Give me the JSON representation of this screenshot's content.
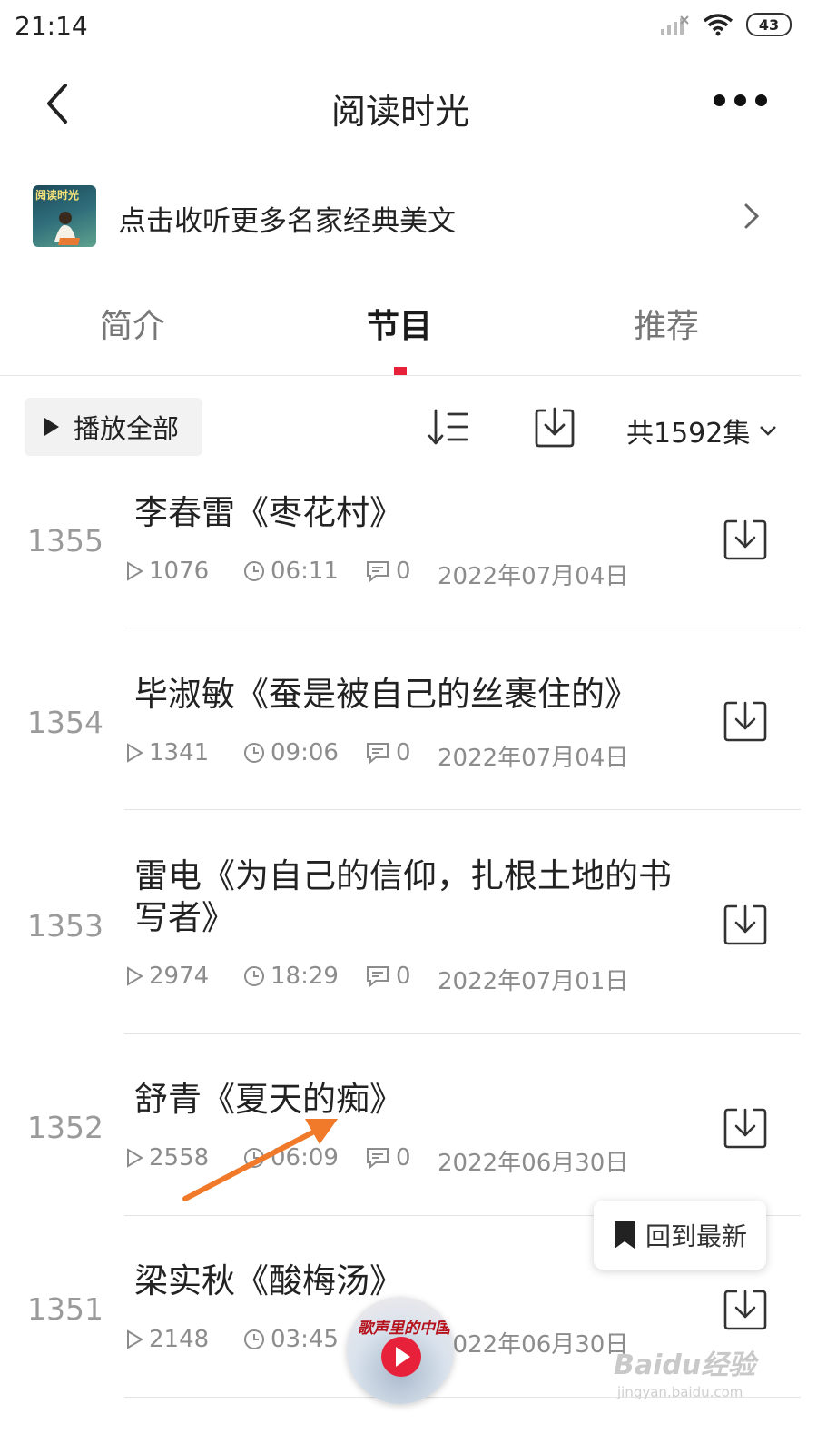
{
  "status_bar": {
    "time": "21:14",
    "battery": "43"
  },
  "header": {
    "title": "阅读时光"
  },
  "banner": {
    "cover_text": "阅读时光",
    "text": "点击收听更多名家经典美文"
  },
  "tabs": [
    {
      "label": "简介",
      "active": false
    },
    {
      "label": "节目",
      "active": true
    },
    {
      "label": "推荐",
      "active": false
    }
  ],
  "toolbar": {
    "play_all": "播放全部",
    "total": "共1592集"
  },
  "episodes": [
    {
      "number": "1355",
      "title": "李春雷《枣花村》",
      "plays": "1076",
      "duration": "06:11",
      "comments": "0",
      "date": "2022年07月04日"
    },
    {
      "number": "1354",
      "title": "毕淑敏《蚕是被自己的丝裹住的》",
      "plays": "1341",
      "duration": "09:06",
      "comments": "0",
      "date": "2022年07月04日"
    },
    {
      "number": "1353",
      "title": "雷电《为自己的信仰，扎根土地的书写者》",
      "plays": "2974",
      "duration": "18:29",
      "comments": "0",
      "date": "2022年07月01日"
    },
    {
      "number": "1352",
      "title": "舒青《夏天的痴》",
      "plays": "2558",
      "duration": "06:09",
      "comments": "0",
      "date": "2022年06月30日"
    },
    {
      "number": "1351",
      "title": "梁实秋《酸梅汤》",
      "plays": "2148",
      "duration": "03:45",
      "comments": "0",
      "date": "2022年06月30日"
    }
  ],
  "floating": {
    "back_to_latest": "回到最新",
    "player_text": "歌声里的中国"
  },
  "watermark": {
    "text": "Baidu经验",
    "sub": "jingyan.baidu.com"
  },
  "colors": {
    "accent": "#e8213a",
    "annotation_arrow": "#f07a2a"
  }
}
